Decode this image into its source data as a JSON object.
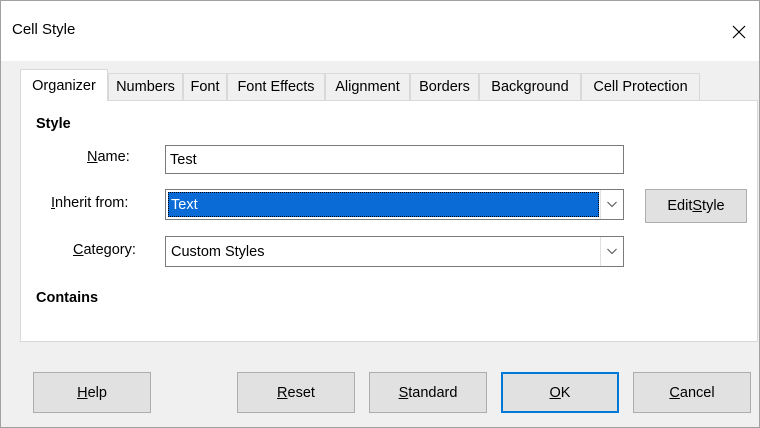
{
  "window": {
    "title": "Cell Style"
  },
  "tabs": [
    {
      "label": "Organizer",
      "active": true
    },
    {
      "label": "Numbers"
    },
    {
      "label": "Font"
    },
    {
      "label": "Font Effects"
    },
    {
      "label": "Alignment"
    },
    {
      "label": "Borders"
    },
    {
      "label": "Background"
    },
    {
      "label": "Cell Protection"
    }
  ],
  "organizer": {
    "style_section": "Style",
    "name": {
      "label_mnemonic": "N",
      "label_rest": "ame:",
      "value": "Test"
    },
    "inherit": {
      "label_mnemonic": "I",
      "label_rest": "nherit from:",
      "value": "Text"
    },
    "edit_style": {
      "label_pre": "Edit ",
      "label_mnemonic": "S",
      "label_rest": "tyle"
    },
    "category": {
      "label_mnemonic": "C",
      "label_rest": "ategory:",
      "value": "Custom Styles"
    },
    "contains_section": "Contains"
  },
  "buttons": {
    "help": {
      "mnemonic": "H",
      "rest": "elp"
    },
    "reset": {
      "mnemonic": "R",
      "rest": "eset"
    },
    "standard": {
      "mnemonic": "S",
      "rest": "tandard"
    },
    "ok": {
      "mnemonic": "O",
      "rest": "K"
    },
    "cancel": {
      "mnemonic": "C",
      "rest": "ancel"
    }
  },
  "colors": {
    "selection": "#0a6bd7",
    "default_button_border": "#0078d7"
  }
}
